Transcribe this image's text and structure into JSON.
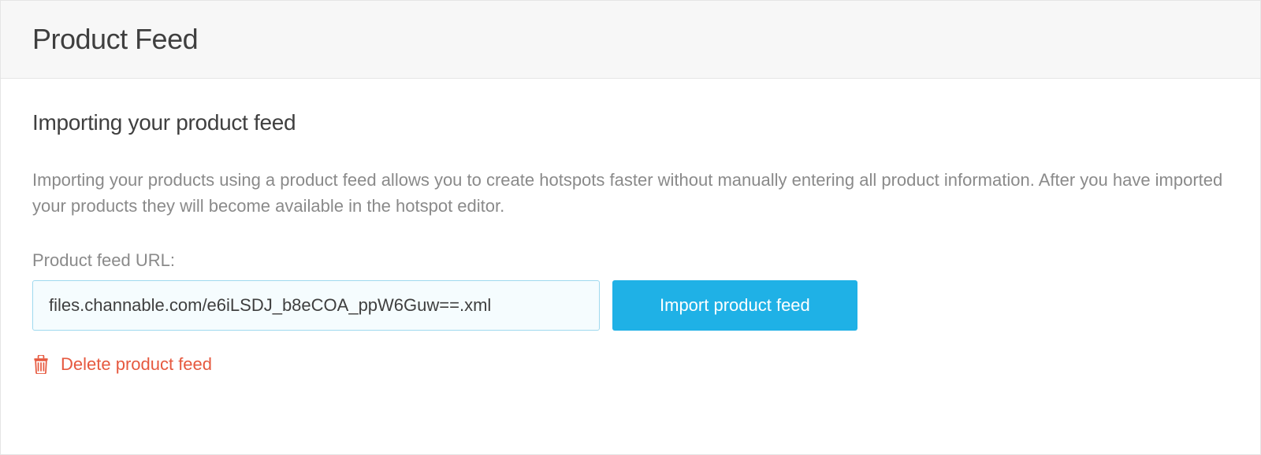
{
  "header": {
    "title": "Product Feed"
  },
  "main": {
    "subtitle": "Importing your product feed",
    "description": "Importing your products using a product feed allows you to create hotspots faster without manually entering all product information. After you have imported your products they will become available in the hotspot editor.",
    "field_label": "Product feed URL:",
    "url_value": "files.channable.com/e6iLSDJ_b8eCOA_ppW6Guw==.xml",
    "import_button": "Import product feed",
    "delete_button": "Delete product feed"
  }
}
